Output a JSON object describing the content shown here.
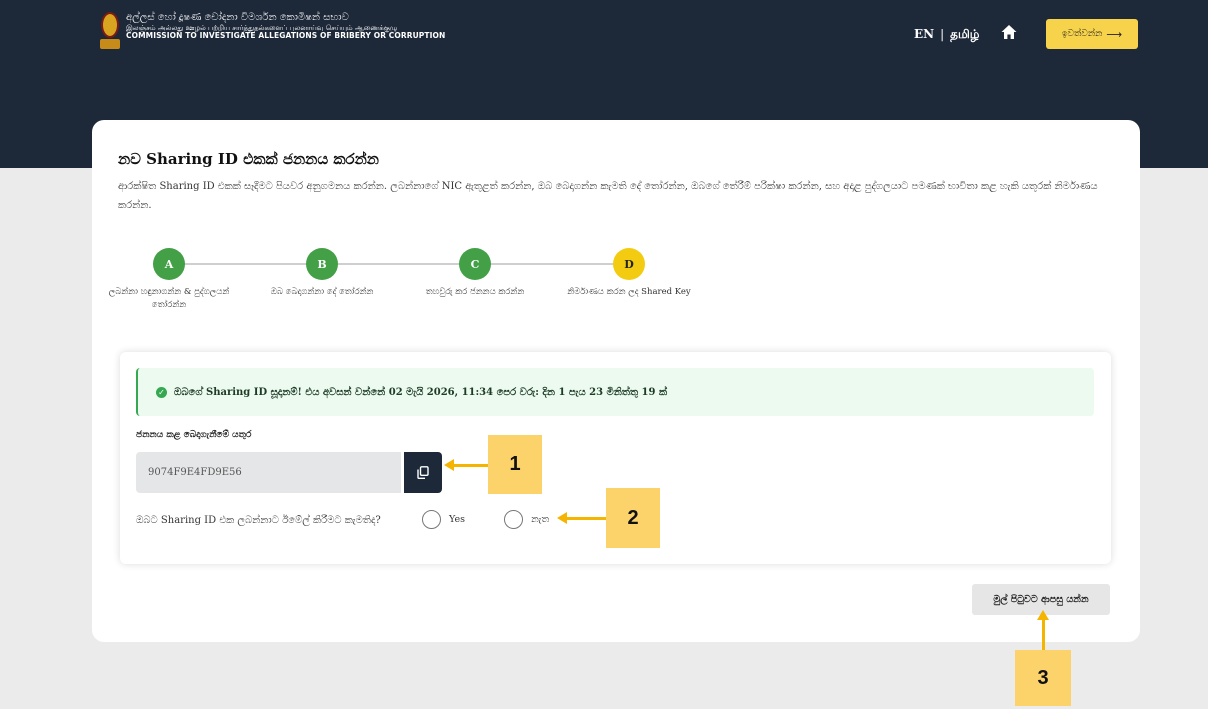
{
  "header": {
    "org_name_si": "අල්ලස් හෝ දූෂණ චෝදනා විමර්ශන කොමිෂන් සභාව",
    "org_name_ta": "இலஞ்சம் அல்லது ஊழல் பற்றிய சார்த்துதல்களைப் புலனாய்வு செய்யும் ஆணைக்குழு",
    "org_name_en": "COMMISSION TO INVESTIGATE ALLEGATIONS OF BRIBERY OR CORRUPTION",
    "lang_en": "EN",
    "lang_separator": "|",
    "lang_ta": "தமிழ்",
    "logout_label": "ඉවත්වන්න",
    "logout_arrow": "⟶"
  },
  "page": {
    "title": "නව Sharing ID එකක් ජනනය කරන්න",
    "description": "ආරක්ෂිත Sharing ID එකක් සෑදීමට පියවර අනුගමනය කරන්න. ලබන්නාගේ NIC ඇතුළත් කරන්න, ඔබ බෙදාගන්න කැමති දේ තෝරන්න, ඔබගේ තේරීම් පරික්ෂා කරන්න, සහ අදාළ පුද්ගලයාට පමණක් භාවිතා කළ හැකි යතුරක් නිර්මාණය කරන්න."
  },
  "steps": [
    {
      "letter": "A",
      "label": "ලබන්නා හඳුනාගන්න & පුද්ගලයන් තෝරන්න",
      "color": "#43a047"
    },
    {
      "letter": "B",
      "label": "ඔබ බෙදාගන්නා දේ තෝරන්න",
      "color": "#43a047"
    },
    {
      "letter": "C",
      "label": "තහවුරු කර ජනනය කරන්න",
      "color": "#43a047"
    },
    {
      "letter": "D",
      "label": "නිර්මාණය කරන ලද Shared Key",
      "color": "#f3cc12"
    }
  ],
  "result": {
    "alert_text": "ඔබගේ Sharing ID සූදානම්! එය අවසන් වන්නේ 02 මැයි 2026, 11:34 පෙර වරු: දින 1 පැය 23 මිනිත්තු 19 ක්",
    "key_label": "ජනනය කළ බෙදාගැනීමේ යතුර",
    "key_value": "9074F9E4FD9E56",
    "email_question": "ඔබට Sharing ID එක ලබන්නාට ඊමේල් කිරීමට කැමතිද?",
    "option_yes": "Yes",
    "option_no": "නැත"
  },
  "actions": {
    "back_label": "මුල් පිටුවට ආපසු යන්න"
  },
  "callouts": [
    "1",
    "2",
    "3"
  ],
  "colors": {
    "navy": "#1d2839",
    "yellow": "#f7d34b",
    "green": "#43a047",
    "callout": "#fcd36b"
  }
}
